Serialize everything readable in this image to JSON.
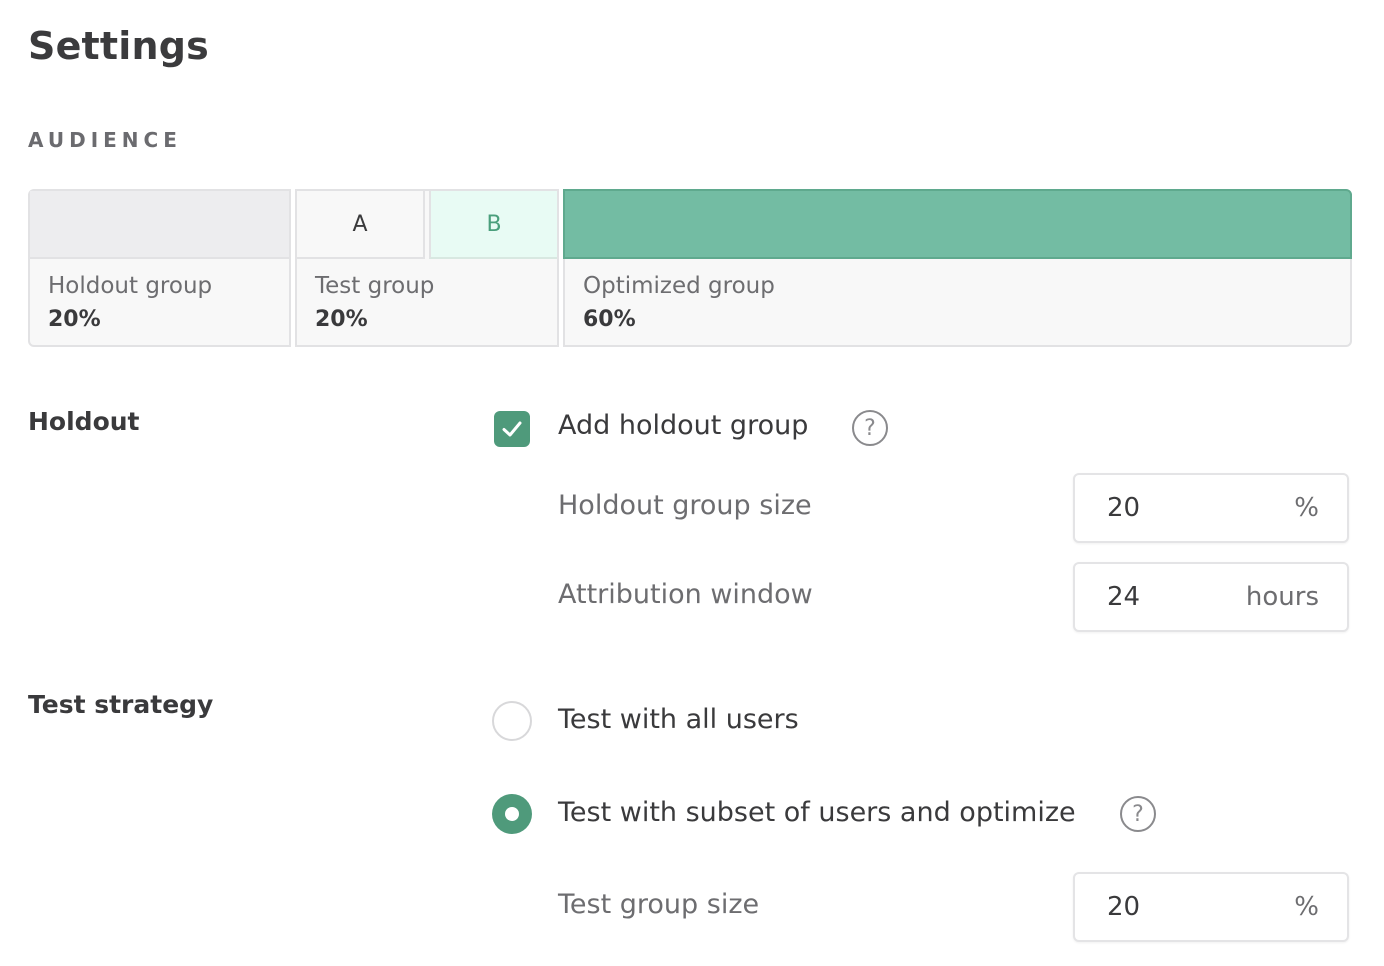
{
  "page": {
    "title": "Settings"
  },
  "audience": {
    "section_label": "AUDIENCE",
    "segments": [
      {
        "name": "holdout",
        "label": "Holdout group",
        "percent": "20%"
      },
      {
        "name": "test",
        "label": "Test group",
        "percent": "20%",
        "variants": [
          "A",
          "B"
        ]
      },
      {
        "name": "optimized",
        "label": "Optimized group",
        "percent": "60%"
      }
    ],
    "colors": {
      "optimized": "#73bca3",
      "variant_b_bg": "#e8fbf4",
      "holdout_bg": "#ededef"
    }
  },
  "holdout": {
    "label": "Holdout",
    "add_holdout": {
      "label": "Add holdout group",
      "checked": true,
      "help_icon": "question-circle-icon"
    },
    "holdout_group_size": {
      "label": "Holdout group size",
      "value": "20",
      "unit": "%"
    },
    "attribution_window": {
      "label": "Attribution window",
      "value": "24",
      "unit": "hours"
    }
  },
  "test_strategy": {
    "label": "Test strategy",
    "options": [
      {
        "label": "Test with all users",
        "selected": false
      },
      {
        "label": "Test with subset of users and optimize",
        "selected": true,
        "help_icon": "question-circle-icon"
      }
    ],
    "test_group_size": {
      "label": "Test group size",
      "value": "20",
      "unit": "%"
    }
  },
  "accent_color": "#4f9a7b"
}
